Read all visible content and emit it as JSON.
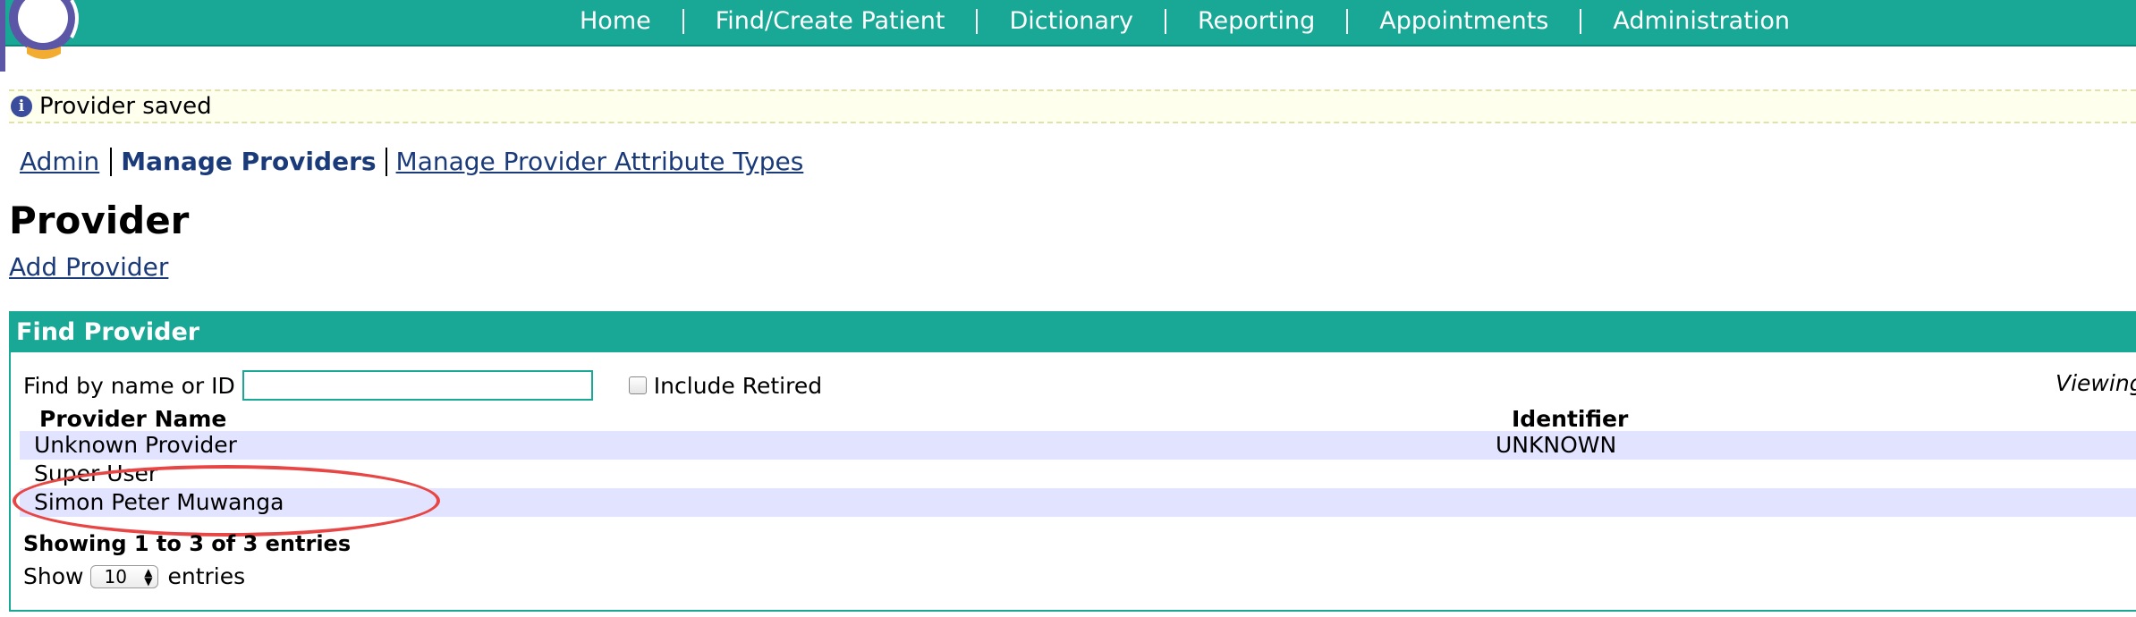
{
  "nav": {
    "items": [
      {
        "label": "Home"
      },
      {
        "label": "Find/Create Patient"
      },
      {
        "label": "Dictionary"
      },
      {
        "label": "Reporting"
      },
      {
        "label": "Appointments"
      },
      {
        "label": "Administration"
      }
    ]
  },
  "info": {
    "icon": "info-icon",
    "message": "Provider saved"
  },
  "breadcrumb": {
    "admin": "Admin",
    "manage_providers": "Manage Providers",
    "manage_attribute_types": "Manage Provider Attribute Types"
  },
  "page": {
    "title": "Provider",
    "add_provider": "Add Provider"
  },
  "find": {
    "header": "Find Provider",
    "search_label": "Find by name or ID",
    "search_value": "",
    "include_retired_label": "Include Retired",
    "viewing_label": "Viewing",
    "columns": {
      "name": "Provider Name",
      "identifier": "Identifier"
    },
    "rows": [
      {
        "name": "Unknown Provider",
        "identifier": "UNKNOWN"
      },
      {
        "name": "Super User",
        "identifier": ""
      },
      {
        "name": "Simon Peter Muwanga",
        "identifier": ""
      }
    ],
    "showing": "Showing 1 to 3 of 3 entries",
    "show_label": "Show",
    "page_size": "10",
    "entries_label": "entries"
  },
  "colors": {
    "brand": "#1aa896",
    "link": "#1a3a7a",
    "row_stripe": "#e2e4ff",
    "annotation": "#e84545"
  }
}
